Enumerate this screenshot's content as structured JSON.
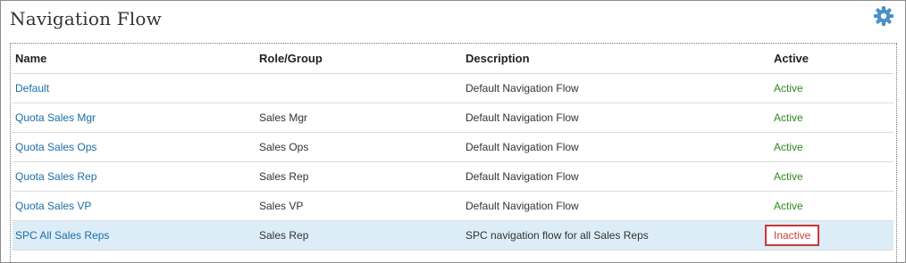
{
  "header": {
    "title": "Navigation Flow",
    "settings_icon": "gear-icon",
    "accent_color": "#4a90c8"
  },
  "table": {
    "columns": [
      "Name",
      "Role/Group",
      "Description",
      "Active"
    ],
    "rows": [
      {
        "name": "Default",
        "role": "",
        "description": "Default Navigation Flow",
        "active": "Active"
      },
      {
        "name": "Quota Sales Mgr",
        "role": "Sales Mgr",
        "description": "Default Navigation Flow",
        "active": "Active"
      },
      {
        "name": "Quota Sales Ops",
        "role": "Sales Ops",
        "description": "Default Navigation Flow",
        "active": "Active"
      },
      {
        "name": "Quota Sales Rep",
        "role": "Sales Rep",
        "description": "Default Navigation Flow",
        "active": "Active"
      },
      {
        "name": "Quota Sales VP",
        "role": "Sales VP",
        "description": "Default Navigation Flow",
        "active": "Active"
      },
      {
        "name": "SPC All Sales Reps",
        "role": "Sales Rep",
        "description": "SPC navigation flow for all Sales Reps",
        "active": "Inactive"
      }
    ],
    "selected_row": "SPC All Sales Reps"
  },
  "colors": {
    "link": "#1a6ea8",
    "active": "#2e8a1e",
    "inactive": "#d13b3b",
    "selected_row_bg": "#dcedf8"
  }
}
